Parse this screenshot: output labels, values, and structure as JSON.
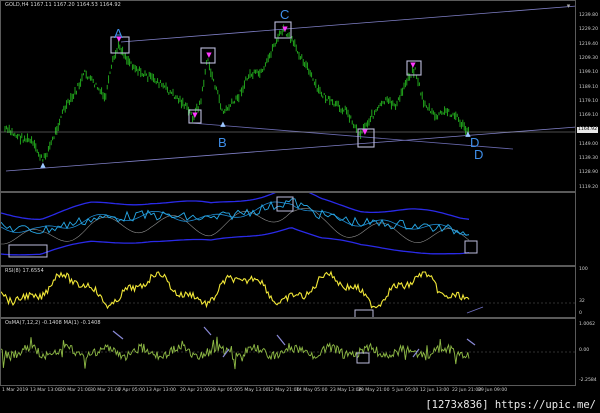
{
  "main_panel": {
    "header": "GOLD,H4  1167.11 1167.20 1164.53 1164.92",
    "price_ticks": [
      "1239.80",
      "1229.20",
      "1219.40",
      "1209.30",
      "1199.10",
      "1189.10",
      "1179.10",
      "1169.10",
      "1158.90",
      "1149.00",
      "1139.30",
      "1128.90",
      "1119.20"
    ],
    "current_price": "1164.92",
    "wave_labels": {
      "A": "A",
      "B": "B",
      "C": "C",
      "D1": "D",
      "D2": "D"
    }
  },
  "indicator_2": {
    "ticks": []
  },
  "indicator_rsi": {
    "header": "RSI(8) 17.6554",
    "ticks": [
      "100",
      "32",
      "0"
    ]
  },
  "indicator_osma": {
    "header": "OsMA(7,12,2) -0.1408  MA(1) -0.1408",
    "ticks": [
      "1.0062",
      "0.00",
      "-2.2584"
    ]
  },
  "x_axis": {
    "labels": [
      "1 Mar 2019",
      "13 Mar 13:00",
      "20 Mar 21:00",
      "30 Mar 21:00",
      "7 Apr 05:00",
      "13 Apr 13:00",
      "20 Apr 21:00",
      "28 Apr 05:00",
      "5 May 13:00",
      "12 May 21:00",
      "14 May 05:00",
      "23 May 13:00",
      "29 May 21:00",
      "5 Jun 05:00",
      "12 Jun 13:00",
      "22 Jun 21:00",
      "29 Jun 09:00"
    ]
  },
  "footer": {
    "text": "[1273x836] https://upic.me/"
  },
  "colors": {
    "price": "#25b41f",
    "envelope": "#2a2ae8",
    "inner": "#27a9e8",
    "rsi": "#f2e838",
    "osma": "#8fbb46",
    "wave": "#3f8ee8",
    "marker": "#ff38ff",
    "box": "#bcbcdc"
  }
}
